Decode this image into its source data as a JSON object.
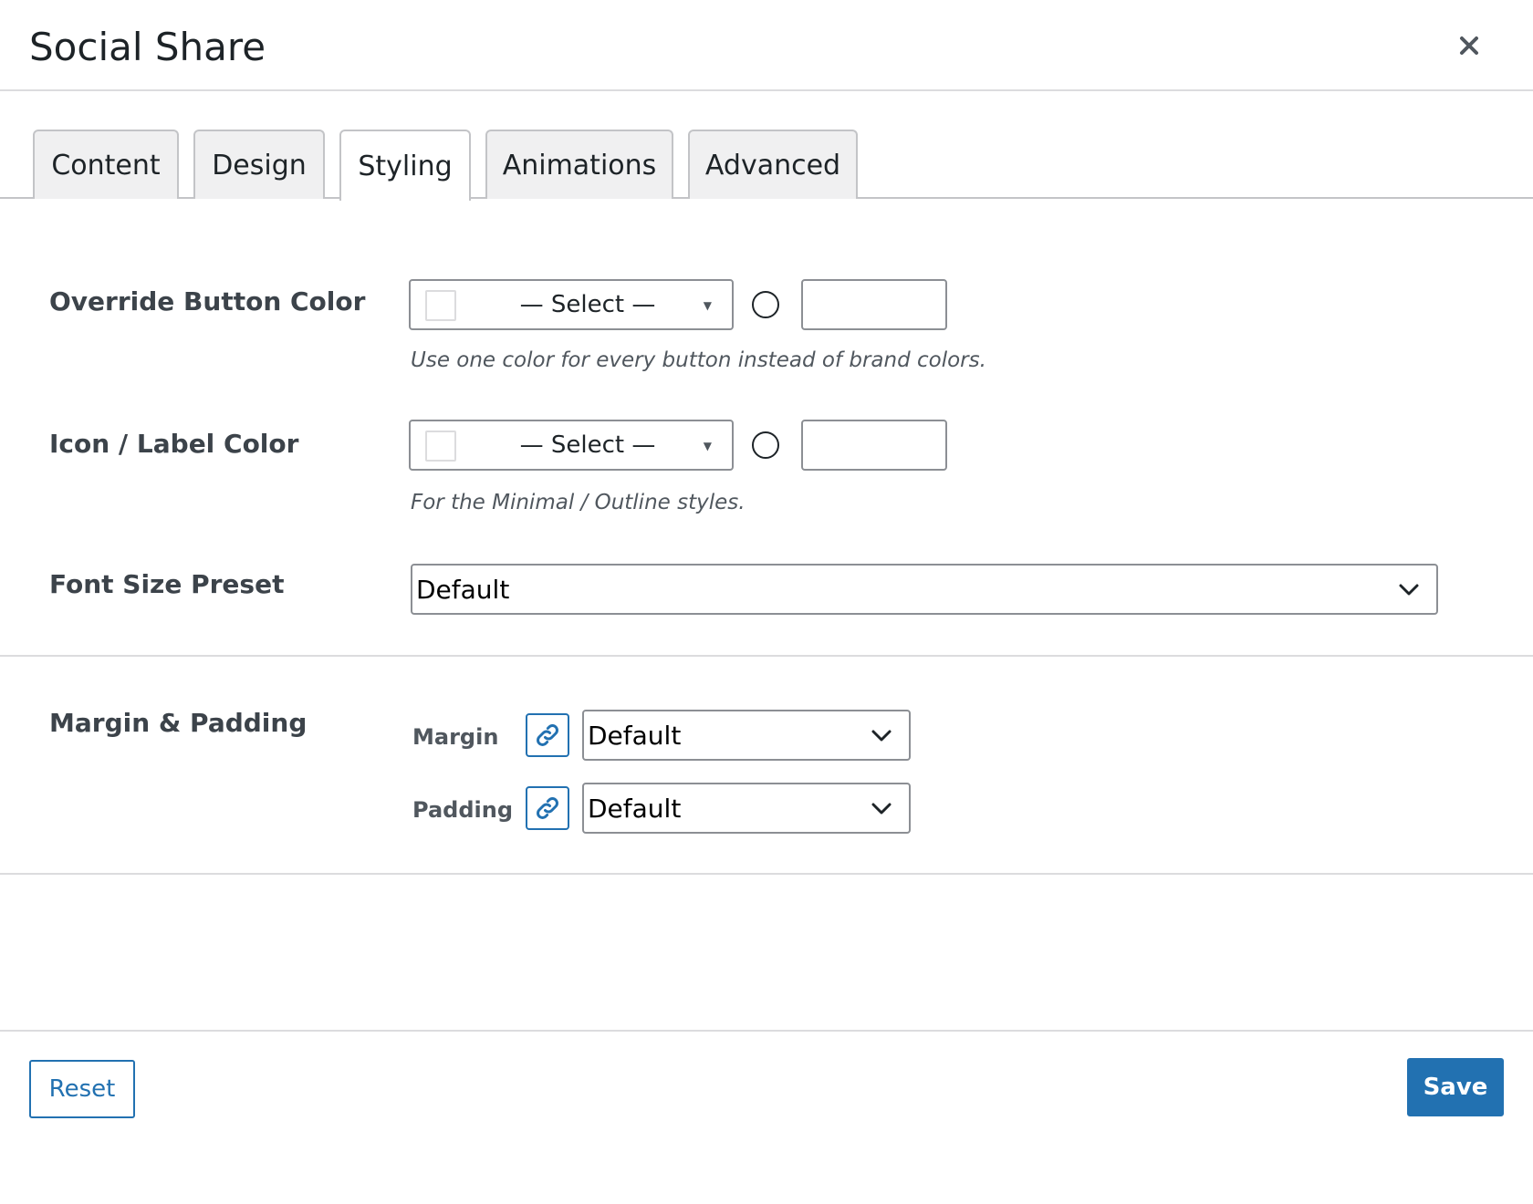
{
  "dialog": {
    "title": "Social Share",
    "close_icon": "close-icon"
  },
  "tabs": [
    {
      "label": "Content",
      "active": false
    },
    {
      "label": "Design",
      "active": false
    },
    {
      "label": "Styling",
      "active": true
    },
    {
      "label": "Animations",
      "active": false
    },
    {
      "label": "Advanced",
      "active": false
    }
  ],
  "fields": {
    "override_button_color": {
      "label": "Override Button Color",
      "select_value": "— Select —",
      "hex_value": "",
      "help": "Use one color for every button instead of brand colors."
    },
    "icon_label_color": {
      "label": "Icon / Label Color",
      "select_value": "— Select —",
      "hex_value": "",
      "help": "For the Minimal / Outline styles."
    },
    "font_size_preset": {
      "label": "Font Size Preset",
      "value": "Default"
    },
    "margin_padding": {
      "label": "Margin & Padding",
      "margin": {
        "label": "Margin",
        "value": "Default",
        "link_icon": "link-icon"
      },
      "padding": {
        "label": "Padding",
        "value": "Default",
        "link_icon": "link-icon"
      }
    }
  },
  "footer": {
    "reset_label": "Reset",
    "save_label": "Save"
  },
  "colors": {
    "accent": "#2271b1",
    "border": "#8c8f94",
    "divider": "#dcdcde",
    "tab_bg": "#f0f0f1",
    "text": "#1d2327",
    "muted": "#50575e"
  }
}
